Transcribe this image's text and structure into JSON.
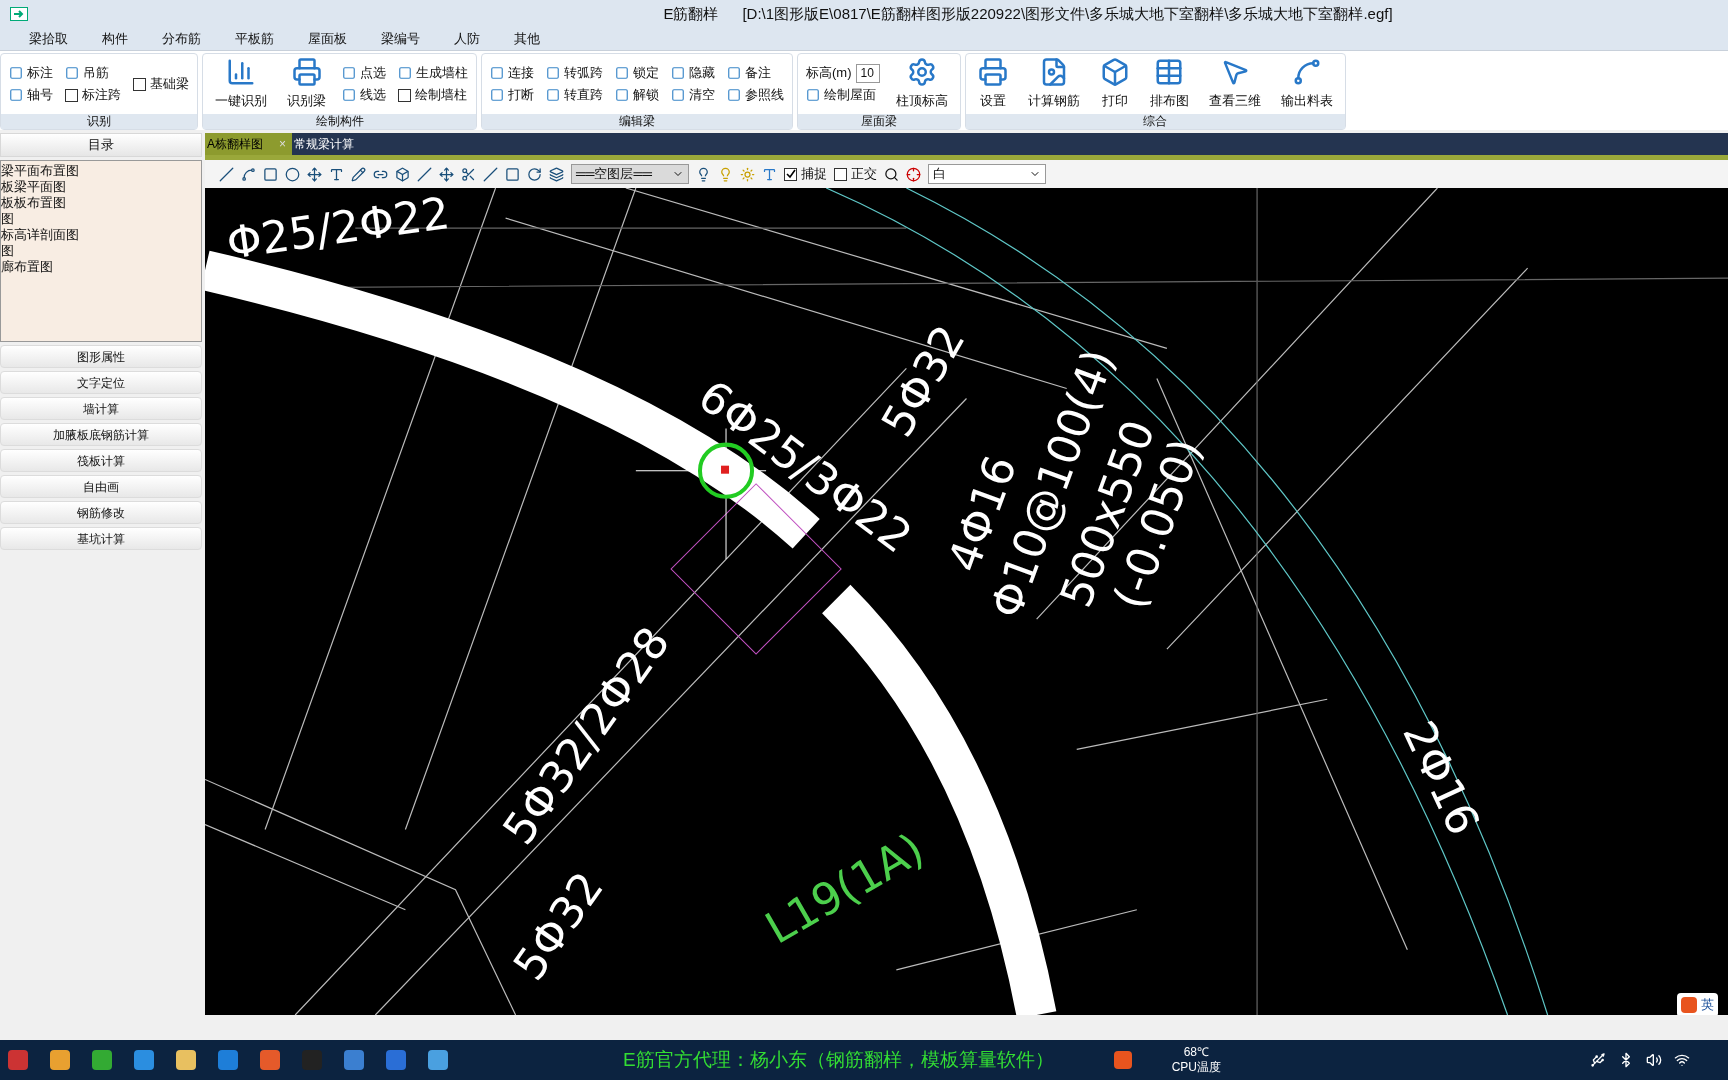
{
  "title_bar": {
    "title": "E筋翻样",
    "path": "[D:\\1图形版E\\0817\\E筋翻样图形版220922\\图形文件\\多乐城大地下室翻样\\多乐城大地下室翻样.egf]"
  },
  "menu_tabs": [
    {
      "label": "梁拾取",
      "selected": false
    },
    {
      "label": "构件",
      "selected": false
    },
    {
      "label": "分布筋",
      "selected": false
    },
    {
      "label": "平板筋",
      "selected": false
    },
    {
      "label": "屋面板",
      "selected": false
    },
    {
      "label": "梁编号",
      "selected": false
    },
    {
      "label": "人防",
      "selected": false
    },
    {
      "label": "其他",
      "selected": false
    }
  ],
  "ribbon": [
    {
      "label": "识别",
      "columns": [
        [
          {
            "kind": "icon",
            "label": "标注"
          },
          {
            "kind": "icon",
            "label": "轴号"
          }
        ],
        [
          {
            "kind": "icon",
            "label": "吊筋"
          },
          {
            "kind": "checkbox",
            "label": "标注跨",
            "checked": false
          }
        ],
        [
          {
            "kind": "checkbox",
            "label": "基础梁",
            "checked": false
          }
        ]
      ]
    },
    {
      "label": "绘制构件",
      "columns": [
        [
          {
            "kind": "large",
            "label": "一键识别"
          }
        ],
        [
          {
            "kind": "large",
            "label": "识别梁"
          }
        ],
        [
          {
            "kind": "icon",
            "label": "点选"
          },
          {
            "kind": "icon",
            "label": "线选"
          }
        ],
        [
          {
            "kind": "icon",
            "label": "生成墙柱"
          },
          {
            "kind": "checkbox",
            "label": "绘制墙柱",
            "checked": false
          }
        ]
      ]
    },
    {
      "label": "编辑梁",
      "columns": [
        [
          {
            "kind": "icon",
            "label": "连接"
          },
          {
            "kind": "icon",
            "label": "打断"
          }
        ],
        [
          {
            "kind": "icon",
            "label": "转弧跨"
          },
          {
            "kind": "icon",
            "label": "转直跨"
          }
        ],
        [
          {
            "kind": "icon",
            "label": "锁定"
          },
          {
            "kind": "icon",
            "label": "解锁"
          }
        ],
        [
          {
            "kind": "icon",
            "label": "隐藏"
          },
          {
            "kind": "icon",
            "label": "清空"
          }
        ],
        [
          {
            "kind": "icon",
            "label": "备注"
          },
          {
            "kind": "icon",
            "label": "参照线"
          }
        ]
      ]
    },
    {
      "label": "屋面梁",
      "columns": [
        [
          {
            "kind": "field",
            "label": "标高(m)",
            "value": "10"
          },
          {
            "kind": "icon",
            "label": "绘制屋面"
          }
        ],
        [
          {
            "kind": "large",
            "label": "柱顶标高"
          }
        ]
      ]
    },
    {
      "label": "综合",
      "columns": [
        [
          {
            "kind": "large",
            "label": "设置"
          }
        ],
        [
          {
            "kind": "large",
            "label": "计算钢筋"
          }
        ],
        [
          {
            "kind": "large",
            "label": "打印"
          }
        ],
        [
          {
            "kind": "large",
            "label": "排布图"
          }
        ],
        [
          {
            "kind": "large",
            "label": "查看三维"
          }
        ],
        [
          {
            "kind": "large",
            "label": "输出料表"
          }
        ]
      ]
    }
  ],
  "sidebar": {
    "header": "目录",
    "items": [
      "梁平面布置图",
      "板梁平面图",
      "板板布置图",
      "图",
      "标高详剖面图",
      "图",
      "廊布置图"
    ],
    "buttons": [
      "图形属性",
      "文字定位",
      "墙计算",
      "加腋板底钢筋计算",
      "筏板计算",
      "自由画",
      "钢筋修改",
      "基坑计算"
    ]
  },
  "doc_tabs": [
    {
      "label": "A栋翻样图",
      "selected": true,
      "close": "×"
    },
    {
      "label": "常规梁计算",
      "selected": false
    }
  ],
  "toolbar": {
    "layer": "══空图层══",
    "snap": {
      "label": "捕捉",
      "checked": true
    },
    "ortho": {
      "label": "正交",
      "checked": false
    },
    "color_label": "白"
  },
  "canvas_labels": [
    {
      "text": "Φ25/2Φ22",
      "color": "#ffffff"
    },
    {
      "text": "6Φ25/3Φ22",
      "color": "#ffffff"
    },
    {
      "text": "5Φ32",
      "color": "#ffffff"
    },
    {
      "text": "4Φ16",
      "color": "#ffffff"
    },
    {
      "text": "Φ10@100(4)",
      "color": "#ffffff"
    },
    {
      "text": "500x550",
      "color": "#ffffff"
    },
    {
      "text": "(-0.050)",
      "color": "#ffffff"
    },
    {
      "text": "5Φ32/2Φ28",
      "color": "#ffffff"
    },
    {
      "text": "2Φ16",
      "color": "#ffffff"
    },
    {
      "text": "L19(1A)",
      "color": "#4ccf4c"
    },
    {
      "text": "5Φ32",
      "color": "#ffffff"
    }
  ],
  "ime": "英",
  "taskbar": {
    "banner": "E筋官方代理：杨小东（钢筋翻样，模板算量软件）",
    "temperature": "68℃",
    "temperature_label": "CPU温度"
  }
}
